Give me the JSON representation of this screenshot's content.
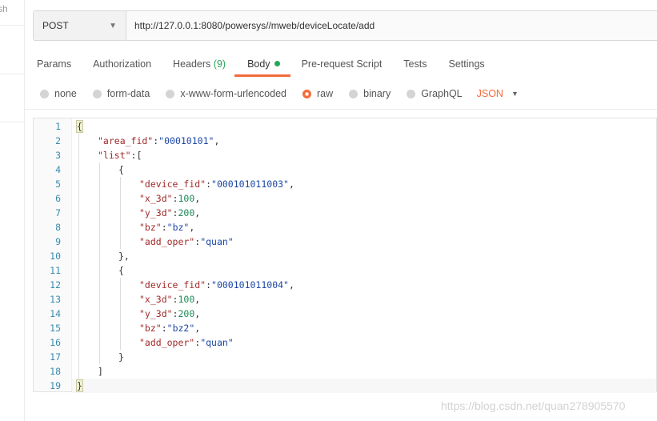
{
  "left_panel": {
    "cut_text": "sh"
  },
  "request": {
    "method": "POST",
    "url": "http://127.0.0.1:8080/powersys//mweb/deviceLocate/add"
  },
  "tabs": [
    {
      "label": "Params"
    },
    {
      "label": "Authorization"
    },
    {
      "label": "Headers",
      "count": "(9)"
    },
    {
      "label": "Body",
      "active": true
    },
    {
      "label": "Pre-request Script"
    },
    {
      "label": "Tests"
    },
    {
      "label": "Settings"
    }
  ],
  "body_types": [
    {
      "label": "none"
    },
    {
      "label": "form-data"
    },
    {
      "label": "x-www-form-urlencoded"
    },
    {
      "label": "raw",
      "selected": true
    },
    {
      "label": "binary"
    },
    {
      "label": "GraphQL"
    }
  ],
  "body_format": "JSON",
  "editor_lines": [
    [
      [
        "p",
        "{"
      ]
    ],
    [
      [
        "k",
        "\"area_fid\""
      ],
      [
        "p",
        ":"
      ],
      [
        "s",
        "\"00010101\""
      ],
      [
        "p",
        ","
      ]
    ],
    [
      [
        "k",
        "\"list\""
      ],
      [
        "p",
        ":["
      ]
    ],
    [
      [
        "p",
        "{"
      ]
    ],
    [
      [
        "k",
        "\"device_fid\""
      ],
      [
        "p",
        ":"
      ],
      [
        "s",
        "\"000101011003\""
      ],
      [
        "p",
        ","
      ]
    ],
    [
      [
        "k",
        "\"x_3d\""
      ],
      [
        "p",
        ":"
      ],
      [
        "n",
        "100"
      ],
      [
        "p",
        ","
      ]
    ],
    [
      [
        "k",
        "\"y_3d\""
      ],
      [
        "p",
        ":"
      ],
      [
        "n",
        "200"
      ],
      [
        "p",
        ","
      ]
    ],
    [
      [
        "k",
        "\"bz\""
      ],
      [
        "p",
        ":"
      ],
      [
        "s",
        "\"bz\""
      ],
      [
        "p",
        ","
      ]
    ],
    [
      [
        "k",
        "\"add_oper\""
      ],
      [
        "p",
        ":"
      ],
      [
        "s",
        "\"quan\""
      ]
    ],
    [
      [
        "p",
        "},"
      ]
    ],
    [
      [
        "p",
        "{"
      ]
    ],
    [
      [
        "k",
        "\"device_fid\""
      ],
      [
        "p",
        ":"
      ],
      [
        "s",
        "\"000101011004\""
      ],
      [
        "p",
        ","
      ]
    ],
    [
      [
        "k",
        "\"x_3d\""
      ],
      [
        "p",
        ":"
      ],
      [
        "n",
        "100"
      ],
      [
        "p",
        ","
      ]
    ],
    [
      [
        "k",
        "\"y_3d\""
      ],
      [
        "p",
        ":"
      ],
      [
        "n",
        "200"
      ],
      [
        "p",
        ","
      ]
    ],
    [
      [
        "k",
        "\"bz\""
      ],
      [
        "p",
        ":"
      ],
      [
        "s",
        "\"bz2\""
      ],
      [
        "p",
        ","
      ]
    ],
    [
      [
        "k",
        "\"add_oper\""
      ],
      [
        "p",
        ":"
      ],
      [
        "s",
        "\"quan\""
      ]
    ],
    [
      [
        "p",
        "}"
      ]
    ],
    [
      [
        "p",
        "]"
      ]
    ],
    [
      [
        "p",
        "}"
      ]
    ]
  ],
  "line_numbers": [
    "1",
    "2",
    "3",
    "4",
    "5",
    "6",
    "7",
    "8",
    "9",
    "10",
    "11",
    "12",
    "13",
    "14",
    "15",
    "16",
    "17",
    "18",
    "19"
  ],
  "watermark": "https://blog.csdn.net/quan278905570"
}
